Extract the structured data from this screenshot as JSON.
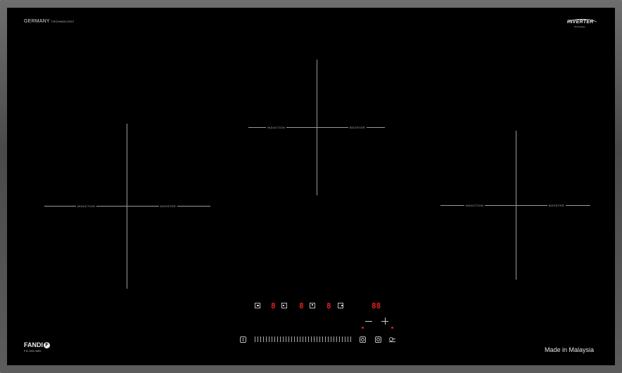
{
  "header": {
    "brand_left": "GERMANY",
    "brand_left_sub": "TECHNOLOGY",
    "inverter_label": "INVERTER",
    "inverter_sub": "Technology"
  },
  "zones": [
    {
      "left_label": "INDUCTION",
      "right_label": "BOOSTER"
    },
    {
      "left_label": "INDUCTION",
      "right_label": "BOOSTER"
    },
    {
      "left_label": "INDUCTION",
      "right_label": "BOOSTER"
    }
  ],
  "controls": {
    "zone_displays": [
      "8",
      "8",
      "8"
    ],
    "timer_display": "88"
  },
  "footer": {
    "brand": "FANDI",
    "brand_mark": "F",
    "model": "FD-930 MRI",
    "made_in": "Made in Malaysia"
  },
  "colors": {
    "glass": "#000000",
    "frame": "#5a5a5a",
    "display": "#e0221f",
    "print": "#d8d8d8"
  }
}
